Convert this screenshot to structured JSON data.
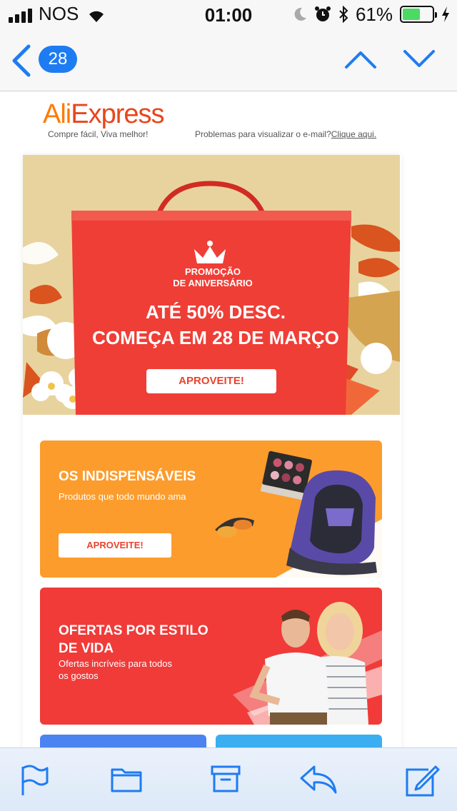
{
  "status_bar": {
    "carrier": "NOS",
    "time": "01:00",
    "battery_percent": "61%",
    "battery_level": 0.61,
    "icons": [
      "signal-icon",
      "wifi-icon",
      "moon-icon",
      "alarm-icon",
      "bluetooth-icon",
      "battery-icon",
      "charging-icon"
    ]
  },
  "nav": {
    "back_count": "28",
    "icons": [
      "back-chevron-icon",
      "previous-message-icon",
      "next-message-icon"
    ]
  },
  "email": {
    "logo": {
      "part1": "Ali",
      "part2": "Express"
    },
    "slogan": "Compre fácil, Viva melhor!",
    "problem_text": "Problemas para visualizar o e-mail?",
    "problem_link": "Clique aqui.",
    "hero": {
      "promo_line1": "PROMOÇÃO",
      "promo_line2": "DE ANIVERSÁRIO",
      "title_line1": "ATÉ 50% DESC.",
      "title_line2": "COMEÇA EM 28 DE MARÇO",
      "button": "APROVEITE!"
    },
    "banners": [
      {
        "title": "OS INDISPENSÁVEIS",
        "subtitle": "Produtos que todo mundo ama",
        "button": "APROVEITE!"
      },
      {
        "title_line1": "OFERTAS POR ESTILO",
        "title_line2": "DE VIDA",
        "subtitle_line1": "Ofertas incríveis para todos",
        "subtitle_line2": "os gostos"
      }
    ]
  },
  "toolbar": {
    "icons": [
      "flag-icon",
      "folder-icon",
      "archive-icon",
      "reply-icon",
      "compose-icon"
    ]
  },
  "colors": {
    "ios_blue": "#1e7cf2",
    "aliexpress_orange": "#ff7a00",
    "aliexpress_red": "#e8461b",
    "hero_bag_red": "#ef3e36",
    "banner_orange": "#fc9c2d",
    "banner_red": "#f03b39",
    "tile_blue": "#4b83f0",
    "tile_cyan": "#3aaef0"
  }
}
